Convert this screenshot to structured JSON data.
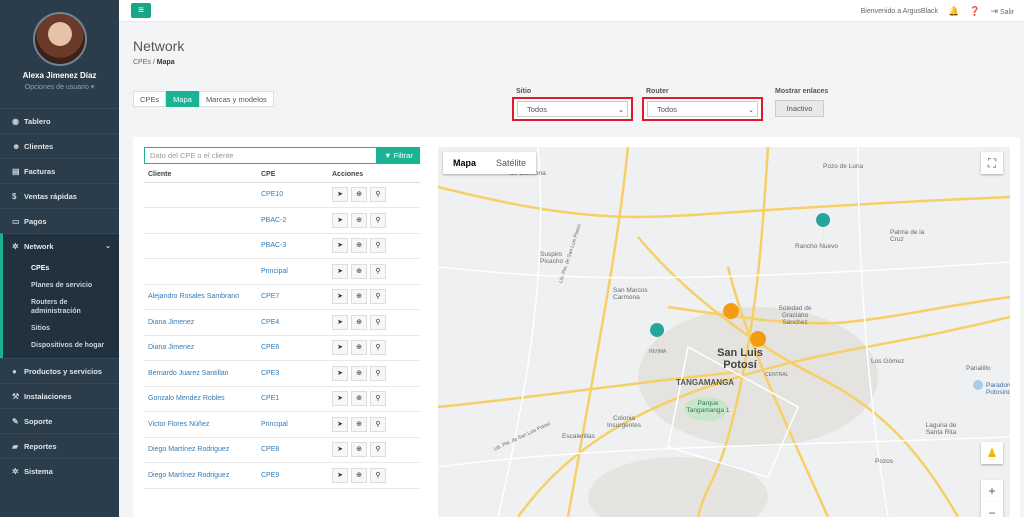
{
  "user": {
    "name": "Alexa Jimenez Díaz",
    "options": "Opciones de usuario ▾"
  },
  "nav": {
    "items": [
      {
        "label": "Tablero",
        "icon": "dashboard-icon",
        "glyph": "◉"
      },
      {
        "label": "Clientes",
        "icon": "users-icon",
        "glyph": "☻"
      },
      {
        "label": "Facturas",
        "icon": "invoice-icon",
        "glyph": "▤"
      },
      {
        "label": "Ventas rápidas",
        "icon": "dollar-icon",
        "glyph": "$"
      },
      {
        "label": "Pagos",
        "icon": "payments-icon",
        "glyph": "▭"
      },
      {
        "label": "Network",
        "icon": "network-icon",
        "glyph": "✲"
      }
    ],
    "network_sub": [
      "CPEs",
      "Planes de servicio",
      "Routers de administración",
      "Sitios",
      "Dispositivos de hogar"
    ],
    "lower": [
      {
        "label": "Productos y servicios",
        "glyph": "●"
      },
      {
        "label": "Instalaciones",
        "glyph": "⚒"
      },
      {
        "label": "Soporte",
        "glyph": "✎"
      },
      {
        "label": "Reportes",
        "glyph": "▰"
      },
      {
        "label": "Sistema",
        "glyph": "✲"
      }
    ]
  },
  "topbar": {
    "welcome": "Bienvenido a ArgusBlack",
    "logout": "Salir"
  },
  "page": {
    "title": "Network",
    "crumb_parent": "CPEs",
    "crumb_current": "Mapa"
  },
  "tabs": [
    "CPEs",
    "Mapa",
    "Marcas y modelos"
  ],
  "filters": {
    "sitio_label": "Sitio",
    "sitio_value": "Todos",
    "router_label": "Router",
    "router_value": "Todos",
    "links_label": "Mostrar enlaces",
    "links_value": "Inactivo"
  },
  "search": {
    "placeholder": "Dato del CPE o el cliente",
    "button": "Filtrar"
  },
  "table": {
    "headers": [
      "Cliente",
      "CPE",
      "Acciones"
    ],
    "rows": [
      {
        "client": "",
        "cpe": "CPE10"
      },
      {
        "client": "",
        "cpe": "PBAC-2"
      },
      {
        "client": "",
        "cpe": "PBAC-3"
      },
      {
        "client": "",
        "cpe": "Principal"
      },
      {
        "client": "Alejandro Rosales Sambrano",
        "cpe": "CPE7"
      },
      {
        "client": "Diana Jimenez",
        "cpe": "CPE4"
      },
      {
        "client": "Diana Jimenez",
        "cpe": "CPE6"
      },
      {
        "client": "Bernardo Juarez Santillan",
        "cpe": "CPE3"
      },
      {
        "client": "Gonzalo Mendez Robles",
        "cpe": "CPE1"
      },
      {
        "client": "Victor Flores Núñez",
        "cpe": "Principal"
      },
      {
        "client": "Diego Martínez Rodriguez",
        "cpe": "CPE8"
      },
      {
        "client": "Diego Martínez Rodriguez",
        "cpe": "CPE9"
      }
    ]
  },
  "map": {
    "type_buttons": [
      "Mapa",
      "Satélite"
    ],
    "labels": {
      "pozo": "Pozo de Luna",
      "rancho": "Rancho Nuevo",
      "palma": "Palma de la Cruz",
      "suspiro": "Suspiro Picacho",
      "sanmarcos": "San Marcos Carmona",
      "carmona": "de Carmona",
      "soledad": "Soledad de Graciano Sánchez",
      "slp": "San Luis Potosí",
      "tangamanga": "TANGAMANGA",
      "parque": "Parque Tangamanga 1",
      "colonia": "Colonia Insurgentes",
      "escalerillas": "Escalerillas",
      "losgomez": "Los Gómez",
      "panalillo": "Panalillo",
      "paradores": "Paradores Potosinos",
      "laguna": "Laguna de Santa Rita",
      "pozos": "Pozos",
      "central": "CENTRAL",
      "invima": "INVIMA",
      "road1": "Lib. Pte. de San Luis Potosí",
      "road2": "Lib. Pte. de San Luis Potosí"
    }
  }
}
